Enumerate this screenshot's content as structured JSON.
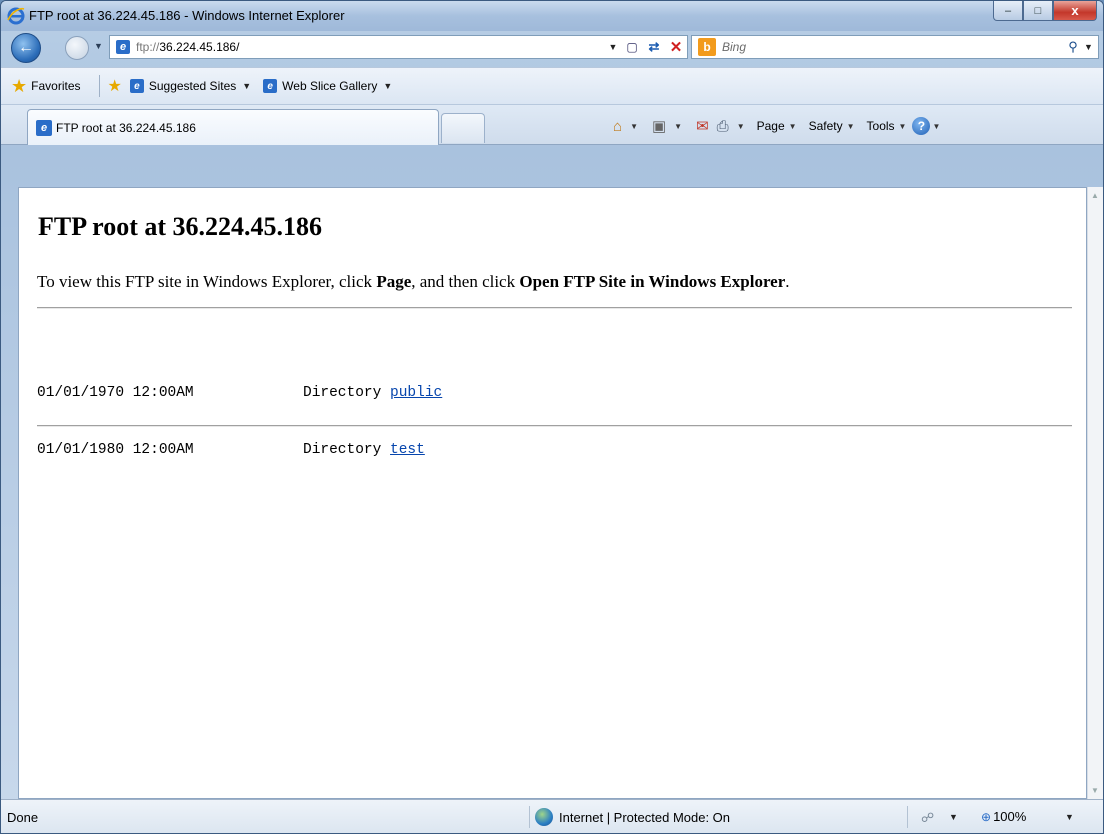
{
  "window": {
    "title": "FTP root at 36.224.45.186 - Windows Internet Explorer",
    "minimize_glyph": "–",
    "maximize_glyph": "□",
    "close_glyph": "x"
  },
  "address_bar": {
    "url_scheme": "ftp://",
    "url_host": "36.224.45.186/"
  },
  "search": {
    "placeholder": "Bing",
    "provider_logo_letter": "b"
  },
  "favorites_bar": {
    "favorites_label": "Favorites",
    "items": [
      {
        "label": "Suggested Sites"
      },
      {
        "label": "Web Slice Gallery"
      }
    ]
  },
  "tabs": [
    {
      "label": "FTP root at 36.224.45.186",
      "active": true
    }
  ],
  "command_bar": {
    "page_label": "Page",
    "safety_label": "Safety",
    "tools_label": "Tools",
    "help_glyph": "?"
  },
  "page": {
    "heading": "FTP root at 36.224.45.186",
    "instruction_prefix": "To view this FTP site in Windows Explorer, click ",
    "instruction_page": "Page",
    "instruction_middle": ", and then click ",
    "instruction_open": "Open FTP Site in Windows Explorer",
    "instruction_suffix": ".",
    "entries": [
      {
        "date": "01/01/1970 12:00AM",
        "type": "Directory",
        "name": "public"
      },
      {
        "date": "01/01/1980 12:00AM",
        "type": "Directory",
        "name": "test"
      }
    ]
  },
  "status_bar": {
    "status": "Done",
    "zone": "Internet | Protected Mode: On",
    "zoom": "100%"
  },
  "icons": {
    "back": "back-arrow-icon",
    "forward": "forward-arrow-icon",
    "refresh": "refresh-icon",
    "stop": "stop-icon",
    "search": "search-icon",
    "home": "home-icon",
    "feeds": "feeds-icon",
    "mail": "read-mail-icon",
    "print": "print-icon",
    "help": "help-icon"
  }
}
